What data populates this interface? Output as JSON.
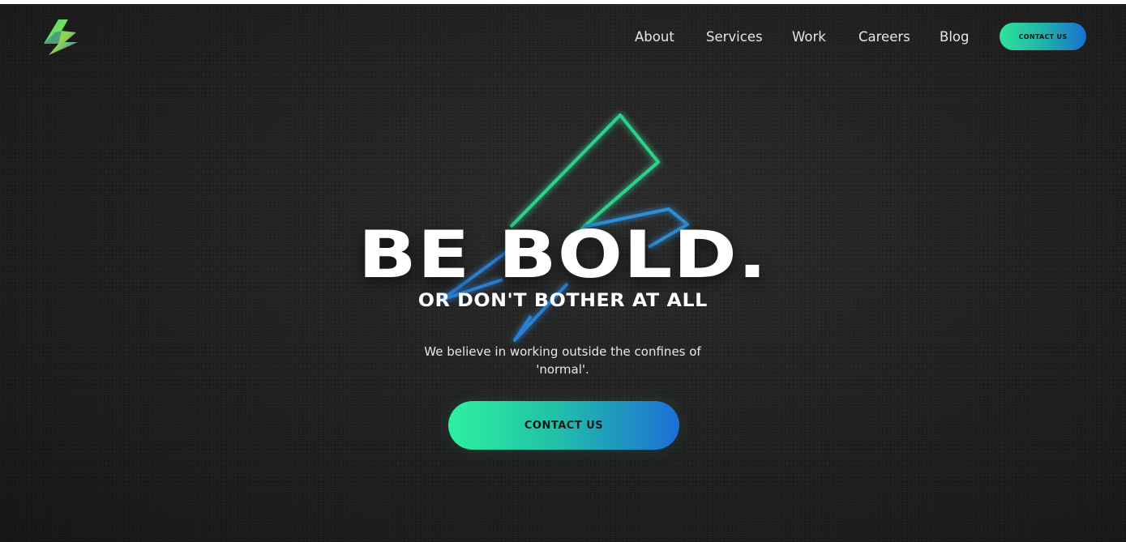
{
  "header": {
    "logo_icon": "lightning-bolt-icon",
    "nav": [
      {
        "label": "About"
      },
      {
        "label": "Services"
      },
      {
        "label": "Work"
      },
      {
        "label": "Careers"
      },
      {
        "label": "Blog"
      }
    ],
    "contact_button": "CONTACT US"
  },
  "hero": {
    "background_icon": "lightning-bolt-outline-icon",
    "headline": "BE BOLD.",
    "subheadline": "OR DON'T BOTHER AT ALL",
    "tagline": "We believe in working outside the confines of 'normal'.",
    "cta_label": "CONTACT US"
  },
  "colors": {
    "background": "#1e1e1e",
    "accent_green": "#2fe39a",
    "accent_blue": "#1a6fd1",
    "text": "#ffffff"
  }
}
